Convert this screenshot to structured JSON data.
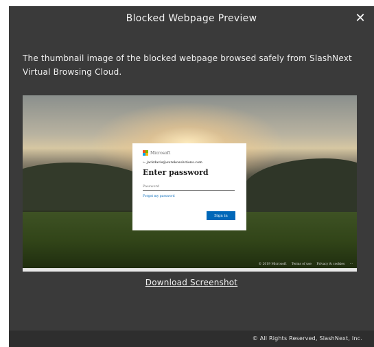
{
  "modal": {
    "title": "Blocked Webpage Preview",
    "close_label": "✕",
    "description": "The thumbnail image of the blocked webpage browsed safely from SlashNext Virtual Browsing Cloud.",
    "download_label": "Download Screenshot",
    "footer_text": "© All Rights Reserved, SlashNext, Inc."
  },
  "thumbnail": {
    "brand": "Microsoft",
    "brand_colors": [
      "#f25022",
      "#7fba00",
      "#00a4ef",
      "#ffb900"
    ],
    "back_email": "← jackdavis@eurekosolutions.com",
    "heading": "Enter password",
    "password_placeholder": "Password",
    "forgot_link": "Forgot my password",
    "signin_label": "Sign in",
    "footer_copyright": "© 2019 Microsoft",
    "footer_terms": "Terms of use",
    "footer_privacy": "Privacy & cookies",
    "footer_more": "···"
  },
  "colors": {
    "modal_bg": "#3a3a3a",
    "footer_bg": "#2e2e2e",
    "accent_blue": "#0067b8"
  }
}
